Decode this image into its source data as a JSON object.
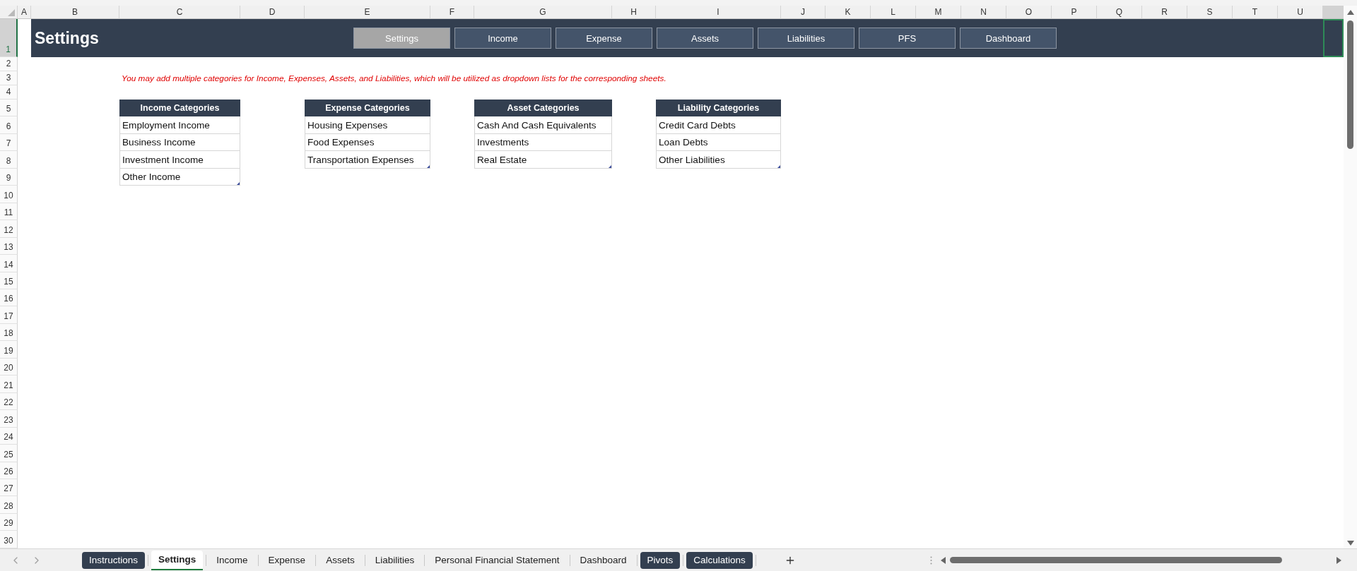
{
  "sheet": {
    "columns": [
      "A",
      "B",
      "C",
      "D",
      "E",
      "F",
      "G",
      "H",
      "I",
      "J",
      "K",
      "L",
      "M",
      "N",
      "O",
      "P",
      "Q",
      "R",
      "S",
      "T",
      "U"
    ],
    "rows": [
      {
        "label": "1",
        "selected": true
      },
      {
        "label": "2",
        "selected": false
      },
      {
        "label": "3",
        "selected": false
      },
      {
        "label": "4",
        "selected": false
      },
      {
        "label": "5",
        "selected": false
      },
      {
        "label": "6",
        "selected": false
      },
      {
        "label": "7",
        "selected": false
      },
      {
        "label": "8",
        "selected": false
      },
      {
        "label": "9",
        "selected": false
      },
      {
        "label": "10",
        "selected": false
      },
      {
        "label": "11",
        "selected": false
      },
      {
        "label": "12",
        "selected": false
      },
      {
        "label": "13",
        "selected": false
      },
      {
        "label": "14",
        "selected": false
      },
      {
        "label": "15",
        "selected": false
      },
      {
        "label": "16",
        "selected": false
      },
      {
        "label": "17",
        "selected": false
      },
      {
        "label": "18",
        "selected": false
      },
      {
        "label": "19",
        "selected": false
      },
      {
        "label": "20",
        "selected": false
      },
      {
        "label": "21",
        "selected": false
      },
      {
        "label": "22",
        "selected": false
      },
      {
        "label": "23",
        "selected": false
      },
      {
        "label": "24",
        "selected": false
      },
      {
        "label": "25",
        "selected": false
      },
      {
        "label": "26",
        "selected": false
      },
      {
        "label": "27",
        "selected": false
      },
      {
        "label": "28",
        "selected": false
      },
      {
        "label": "29",
        "selected": false
      },
      {
        "label": "30",
        "selected": false
      }
    ]
  },
  "banner": {
    "title": "Settings",
    "nav_buttons": [
      {
        "label": "Settings",
        "selected": true
      },
      {
        "label": "Income",
        "selected": false
      },
      {
        "label": "Expense",
        "selected": false
      },
      {
        "label": "Assets",
        "selected": false
      },
      {
        "label": "Liabilities",
        "selected": false
      },
      {
        "label": "PFS",
        "selected": false
      },
      {
        "label": "Dashboard",
        "selected": false
      }
    ]
  },
  "note": "You may add multiple categories for Income, Expenses, Assets, and Liabilities, which will be utilized as dropdown lists for the corresponding sheets.",
  "tables": [
    {
      "header": "Income Categories",
      "items": [
        "Employment Income",
        "Business Income",
        "Investment Income",
        "Other Income"
      ]
    },
    {
      "header": "Expense Categories",
      "items": [
        "Housing Expenses",
        "Food Expenses",
        "Transportation Expenses"
      ]
    },
    {
      "header": "Asset Categories",
      "items": [
        "Cash And Cash Equivalents",
        "Investments",
        "Real Estate"
      ]
    },
    {
      "header": "Liability Categories",
      "items": [
        "Credit Card Debts",
        "Loan Debts",
        "Other Liabilities"
      ]
    }
  ],
  "sheet_tabs": [
    {
      "label": "Instructions",
      "selected": false,
      "kind": "colored"
    },
    {
      "label": "Settings",
      "selected": true,
      "kind": "plain"
    },
    {
      "label": "Income",
      "selected": false,
      "kind": "plain"
    },
    {
      "label": "Expense",
      "selected": false,
      "kind": "plain"
    },
    {
      "label": "Assets",
      "selected": false,
      "kind": "plain"
    },
    {
      "label": "Liabilities",
      "selected": false,
      "kind": "plain"
    },
    {
      "label": "Personal Financial Statement",
      "selected": false,
      "kind": "plain"
    },
    {
      "label": "Dashboard",
      "selected": false,
      "kind": "plain"
    },
    {
      "label": "Pivots",
      "selected": false,
      "kind": "colored"
    },
    {
      "label": "Calculations",
      "selected": false,
      "kind": "colored"
    }
  ]
}
